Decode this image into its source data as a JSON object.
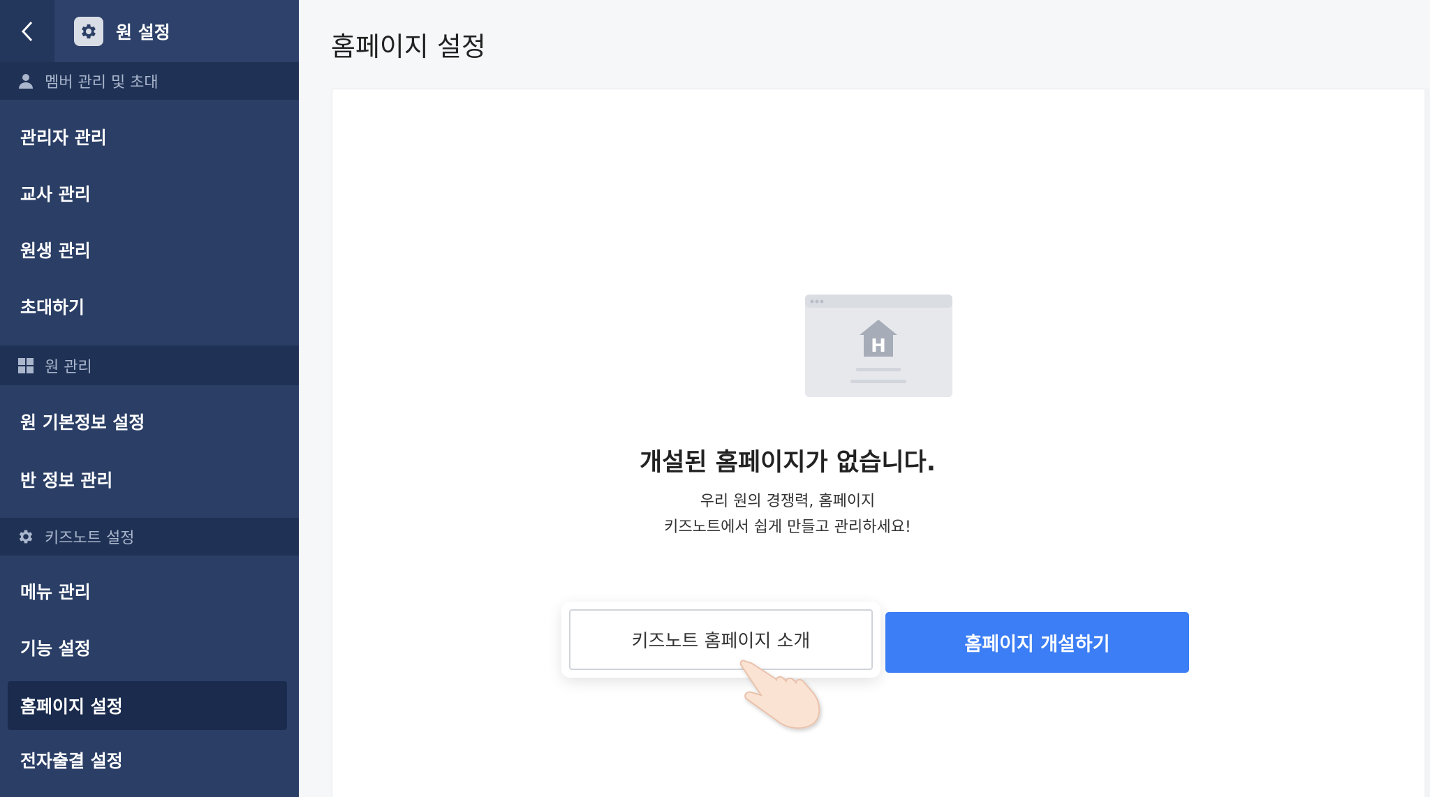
{
  "sidebar": {
    "back_icon": "chevron-left-icon",
    "header_icon": "gear-icon",
    "header_title": "원 설정",
    "sections": [
      {
        "icon": "person-icon",
        "label": "멤버 관리 및 초대",
        "items": [
          "관리자 관리",
          "교사 관리",
          "원생 관리",
          "초대하기"
        ]
      },
      {
        "icon": "grid-icon",
        "label": "원 관리",
        "items": [
          "원 기본정보 설정",
          "반 정보 관리"
        ]
      },
      {
        "icon": "gear-icon",
        "label": "키즈노트 설정",
        "items": [
          "메뉴 관리",
          "기능 설정",
          "홈페이지 설정",
          "전자출결 설정"
        ]
      }
    ],
    "active_item": "홈페이지 설정"
  },
  "main": {
    "page_title": "홈페이지 설정",
    "illustration_icon": "homepage-browser-icon",
    "illustration_letter": "H",
    "empty_title": "개설된 홈페이지가 없습니다.",
    "empty_desc_line1": "우리 원의 경쟁력, 홈페이지",
    "empty_desc_line2": "키즈노트에서 쉽게 만들고 관리하세요!",
    "intro_button": "키즈노트 홈페이지 소개",
    "open_button": "홈페이지 개설하기"
  },
  "colors": {
    "sidebar_bg": "#2a3e66",
    "section_header_bg": "#1f3256",
    "active_item_bg": "#1a2b4d",
    "primary_button": "#3b7ef5"
  }
}
